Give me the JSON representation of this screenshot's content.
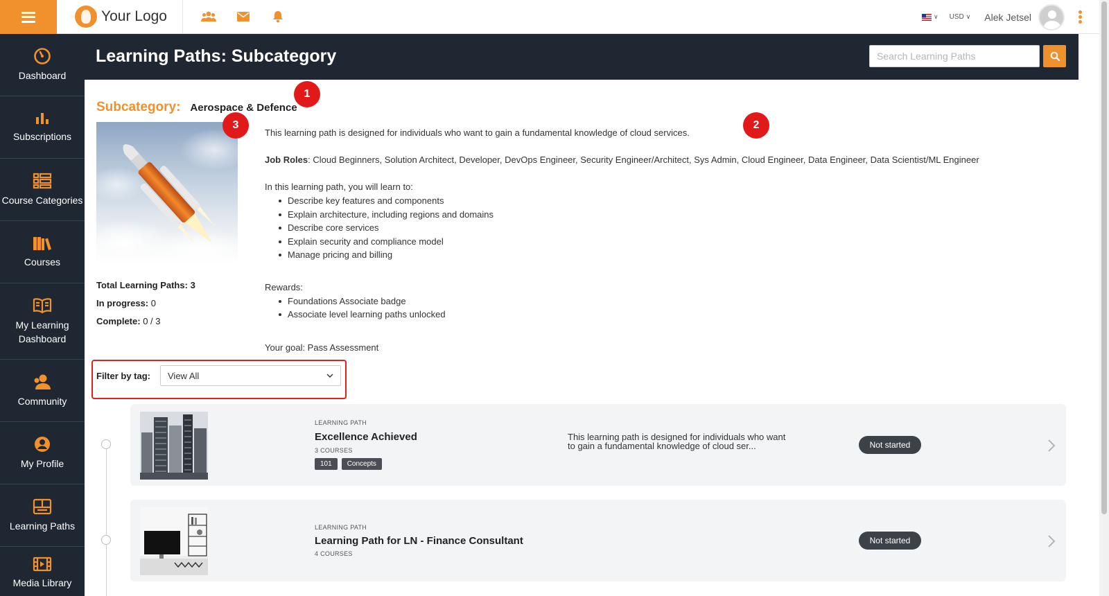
{
  "topbar": {
    "logo_text": "Your Logo",
    "currency": "USD",
    "user_name": "Alek Jetsel",
    "icons": [
      "community-icon",
      "mail-icon",
      "bell-icon"
    ]
  },
  "sidebar": {
    "items": [
      {
        "label": "Dashboard",
        "icon": "dashboard-icon"
      },
      {
        "label": "Subscriptions",
        "icon": "bar-chart-icon"
      },
      {
        "label": "Course Categories",
        "icon": "categories-icon"
      },
      {
        "label": "Courses",
        "icon": "books-icon"
      },
      {
        "label": "My Learning Dashboard",
        "icon": "open-book-icon"
      },
      {
        "label": "Community",
        "icon": "community-icon"
      },
      {
        "label": "My Profile",
        "icon": "user-circle-icon"
      },
      {
        "label": "Learning Paths",
        "icon": "learning-paths-icon"
      },
      {
        "label": "Media Library",
        "icon": "film-icon"
      }
    ]
  },
  "header": {
    "title": "Learning Paths: Subcategory",
    "search_placeholder": "Search Learning Paths"
  },
  "subcategory": {
    "label": "Subcategory:",
    "name": "Aerospace & Defence"
  },
  "stats": {
    "total_label": "Total Learning Paths:",
    "total_value": "3",
    "in_progress_label": "In progress:",
    "in_progress_value": "0",
    "complete_label": "Complete:",
    "complete_value": "0 / 3"
  },
  "description": {
    "intro": "This learning path is designed for individuals who want to gain a fundamental knowledge of cloud services.",
    "job_roles_label": "Job Roles",
    "job_roles": ": Cloud Beginners, Solution Architect, Developer, DevOps Engineer, Security Engineer/Architect, Sys Admin, Cloud Engineer, Data Engineer, Data Scientist/ML Engineer",
    "learn_heading": "In this learning path, you will learn to:",
    "learn_items": [
      "Describe key features and components",
      "Explain architecture, including regions and domains",
      "Describe core services",
      "Explain security and compliance model",
      "Manage pricing and billing"
    ],
    "rewards_heading": "Rewards:",
    "rewards_items": [
      "Foundations Associate badge",
      "Associate level learning paths unlocked"
    ],
    "goal": "Your goal: Pass Assessment"
  },
  "filter": {
    "label": "Filter by tag:",
    "selected": "View All"
  },
  "learning_paths": [
    {
      "kind": "LEARNING PATH",
      "title": "Excellence Achieved",
      "courses": "3 COURSES",
      "tags": [
        "101",
        "Concepts"
      ],
      "description": "This learning path is designed for individuals who want to gain a fundamental knowledge of cloud ser...",
      "status": "Not started"
    },
    {
      "kind": "LEARNING PATH",
      "title": "Learning Path for LN - Finance Consultant",
      "courses": "4 COURSES",
      "tags": [],
      "description": "",
      "status": "Not started"
    }
  ],
  "annotations": [
    "1",
    "2",
    "3"
  ],
  "colors": {
    "accent": "#f0912d",
    "sidebar_bg": "#1f2733",
    "status_badge": "#3d4249",
    "annotation_red": "#e11919"
  }
}
